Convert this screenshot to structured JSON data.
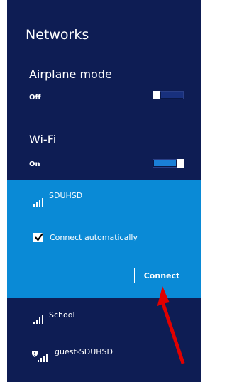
{
  "title": "Networks",
  "airplane": {
    "label": "Airplane mode",
    "state": "Off",
    "on": false
  },
  "wifi": {
    "label": "Wi-Fi",
    "state": "On",
    "on": true
  },
  "networks": [
    {
      "name": "SDUHSD",
      "icon": "wifi-signal-icon",
      "selected": true
    },
    {
      "name": "School",
      "icon": "wifi-signal-icon"
    },
    {
      "name": "guest-SDUHSD",
      "icon": "wifi-signal-secured-icon"
    }
  ],
  "selected_network": {
    "connect_automatically_label": "Connect automatically",
    "connect_automatically_checked": true,
    "connect_button": "Connect"
  },
  "colors": {
    "panel": "#0e1d54",
    "selected": "#0a8ad6",
    "toggle_on": "#1a7fd6",
    "annotation_arrow": "#e00000"
  },
  "annotation": {
    "type": "arrow",
    "points_to": "connect-button"
  }
}
